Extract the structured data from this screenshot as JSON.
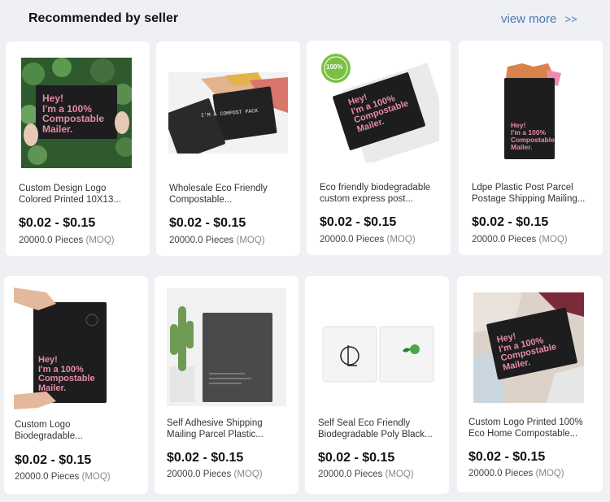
{
  "header": {
    "title": "Recommended by seller",
    "view_more": "view more",
    "view_more_icon": "double-chevron-right-icon",
    "view_more_arrows": ">>"
  },
  "products": [
    {
      "name_line1": "Custom Design Logo",
      "name_line2": "Colored Printed 10X13...",
      "price": "$0.02 - $0.15",
      "moq_qty": "20000.0 Pieces",
      "moq_tag": "(MOQ)",
      "image_text": [
        "Hey!",
        "I'm a 100%",
        "Compostable",
        "Mailer."
      ]
    },
    {
      "name_line1": "Wholesale Eco Friendly",
      "name_line2": "Compostable...",
      "price": "$0.02 - $0.15",
      "moq_qty": "20000.0 Pieces",
      "moq_tag": "(MOQ)",
      "image_text": [
        "I'M A COMPOST PACK"
      ]
    },
    {
      "name_line1": "Eco friendly biodegradable",
      "name_line2": "custom express post...",
      "price": "$0.02 - $0.15",
      "moq_qty": "20000.0 Pieces",
      "moq_tag": "(MOQ)",
      "image_text": [
        "Hey!",
        "I'm a 100%",
        "Compostable",
        "Mailer.",
        "100%"
      ]
    },
    {
      "name_line1": "Ldpe Plastic Post Parcel",
      "name_line2": "Postage Shipping Mailing...",
      "price": "$0.02 - $0.15",
      "moq_qty": "20000.0 Pieces",
      "moq_tag": "(MOQ)",
      "image_text": [
        "Hey!",
        "I'm a 100%",
        "Compostable",
        "Mailer."
      ]
    },
    {
      "name_line1": "Custom Logo",
      "name_line2": "Biodegradable...",
      "price": "$0.02 - $0.15",
      "moq_qty": "20000.0 Pieces",
      "moq_tag": "(MOQ)",
      "image_text": [
        "Hey!",
        "I'm a 100%",
        "Compostable",
        "Mailer."
      ]
    },
    {
      "name_line1": "Self Adhesive Shipping",
      "name_line2": "Mailing Parcel Plastic...",
      "price": "$0.02 - $0.15",
      "moq_qty": "20000.0 Pieces",
      "moq_tag": "(MOQ)",
      "image_text": []
    },
    {
      "name_line1": "Self Seal Eco Friendly",
      "name_line2": "Biodegradable Poly Black...",
      "price": "$0.02 - $0.15",
      "moq_qty": "20000.0 Pieces",
      "moq_tag": "(MOQ)",
      "image_text": []
    },
    {
      "name_line1": "Custom Logo Printed 100%",
      "name_line2": "Eco Home Compostable...",
      "price": "$0.02 - $0.15",
      "moq_qty": "20000.0 Pieces",
      "moq_tag": "(MOQ)",
      "image_text": [
        "Hey!",
        "I'm a 100%",
        "Compostable",
        "Mailer."
      ]
    }
  ],
  "colors": {
    "background": "#eef0f3",
    "card": "#ffffff",
    "link": "#4a78b8",
    "mailer_black": "#1d1d1f",
    "mailer_pink": "#e78aa8",
    "moq_gray": "#8a8a8a"
  }
}
